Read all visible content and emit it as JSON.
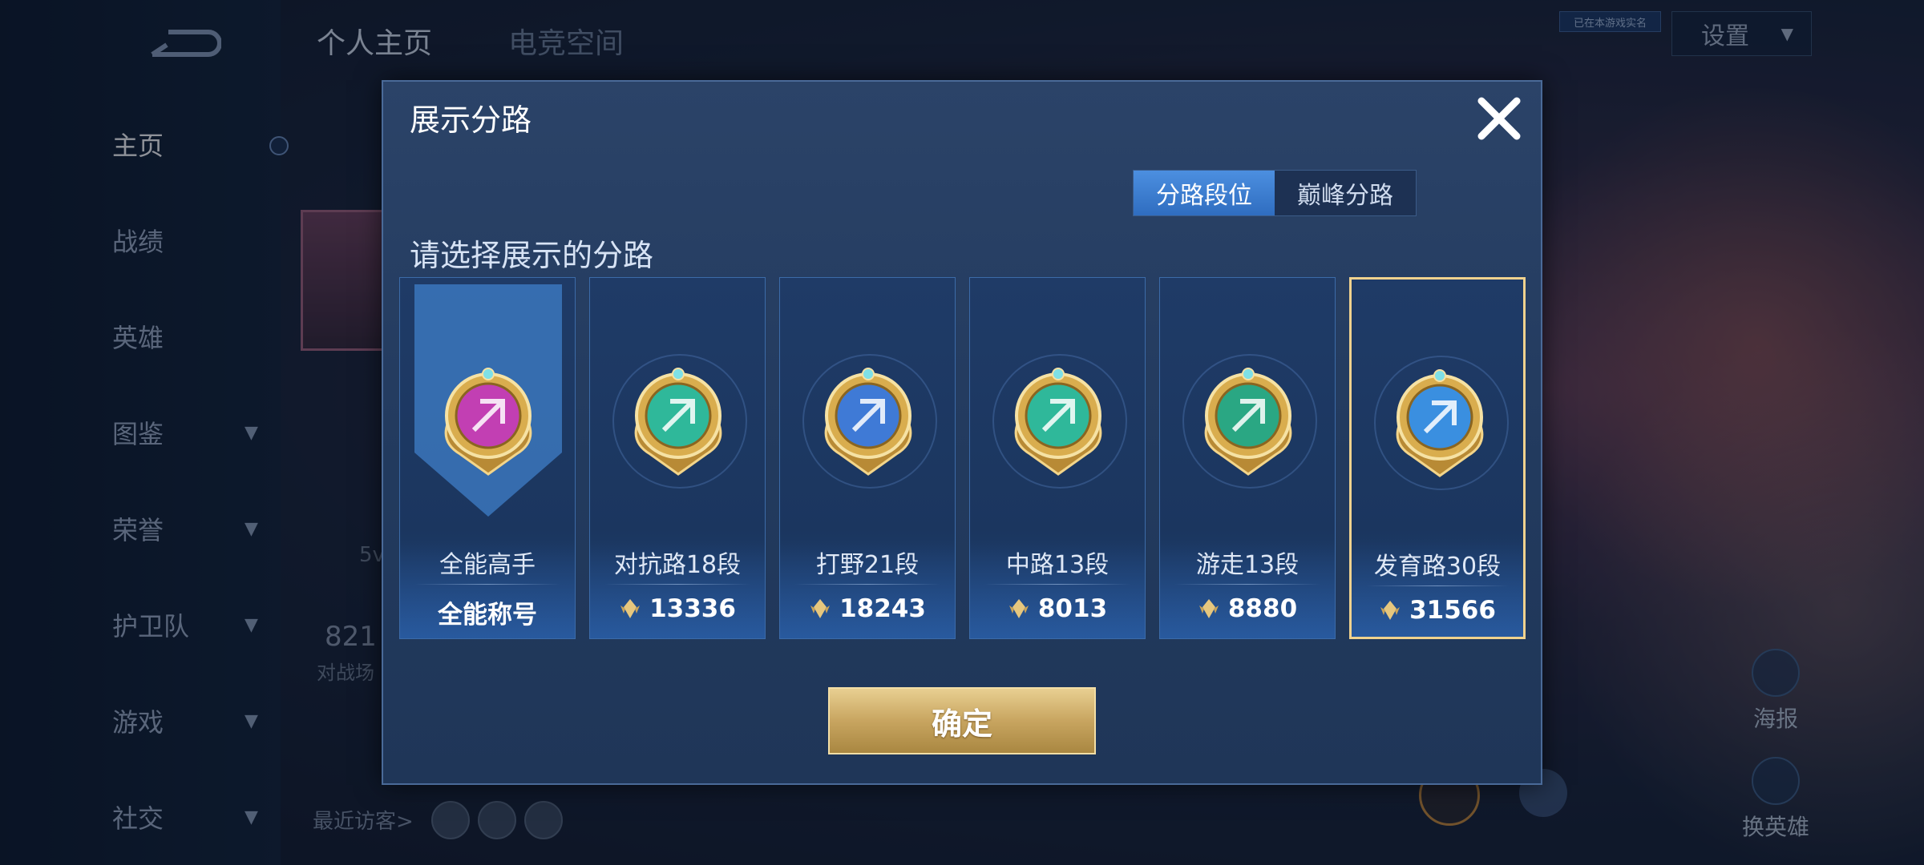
{
  "sidebar": {
    "items": [
      {
        "label": "主页",
        "active": true,
        "expandable": false
      },
      {
        "label": "战绩",
        "active": false,
        "expandable": false
      },
      {
        "label": "英雄",
        "active": false,
        "expandable": false
      },
      {
        "label": "图鉴",
        "active": false,
        "expandable": true
      },
      {
        "label": "荣誉",
        "active": false,
        "expandable": true
      },
      {
        "label": "护卫队",
        "active": false,
        "expandable": true
      },
      {
        "label": "游戏",
        "active": false,
        "expandable": true
      },
      {
        "label": "社交",
        "active": false,
        "expandable": true
      }
    ]
  },
  "header": {
    "tabs": [
      "个人主页",
      "电竞空间"
    ],
    "settings_label": "设置",
    "badge_text": "已在本游戏实名"
  },
  "profile": {
    "stat_partial": "821",
    "stat_label_partial": "对战场",
    "mode_partial": "5v",
    "recent_visitors_label": "最近访客>"
  },
  "right_actions": {
    "poster_label": "海报",
    "change_hero_label": "换英雄"
  },
  "modal": {
    "title": "展示分路",
    "segments": [
      "分路段位",
      "巅峰分路"
    ],
    "active_segment": 0,
    "subtitle": "请选择展示的分路",
    "cards": [
      {
        "name": "全能高手",
        "value": "全能称号",
        "emblem_color": "#c23fb3",
        "has_score_icon": false,
        "selected": false,
        "ribbon": true
      },
      {
        "name": "对抗路18段",
        "value": "13336",
        "emblem_color": "#2fb89a",
        "has_score_icon": true,
        "selected": false,
        "ribbon": false
      },
      {
        "name": "打野21段",
        "value": "18243",
        "emblem_color": "#3f7ad6",
        "has_score_icon": true,
        "selected": false,
        "ribbon": false
      },
      {
        "name": "中路13段",
        "value": "8013",
        "emblem_color": "#2fb89a",
        "has_score_icon": true,
        "selected": false,
        "ribbon": false
      },
      {
        "name": "游走13段",
        "value": "8880",
        "emblem_color": "#2aa783",
        "has_score_icon": true,
        "selected": false,
        "ribbon": false
      },
      {
        "name": "发育路30段",
        "value": "31566",
        "emblem_color": "#3a8fe0",
        "has_score_icon": true,
        "selected": true,
        "ribbon": false
      }
    ],
    "confirm_label": "确定"
  },
  "colors": {
    "accent_gold": "#e8cf91",
    "modal_bg": "#2b4368",
    "segment_active": "#3f7fd5"
  }
}
